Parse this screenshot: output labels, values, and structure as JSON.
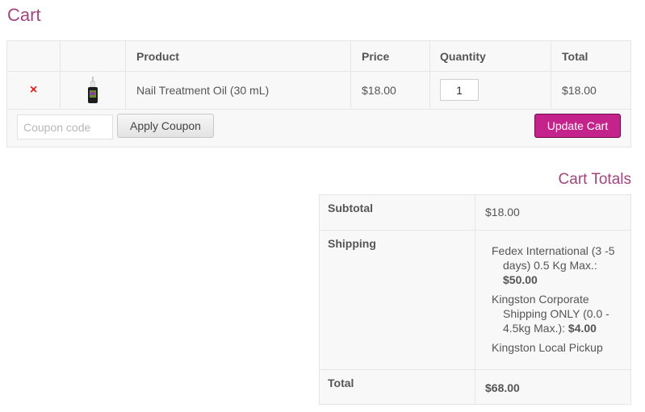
{
  "page": {
    "title": "Cart"
  },
  "cart": {
    "columns": {
      "remove": "",
      "thumbnail": "",
      "product": "Product",
      "price": "Price",
      "quantity": "Quantity",
      "total": "Total"
    },
    "items": [
      {
        "remove_symbol": "×",
        "product": "Nail Treatment Oil (30 mL)",
        "price": "$18.00",
        "quantity": "1",
        "total": "$18.00"
      }
    ],
    "coupon": {
      "placeholder": "Coupon code",
      "value": "",
      "apply_label": "Apply Coupon"
    },
    "update_label": "Update Cart"
  },
  "totals": {
    "title": "Cart Totals",
    "subtotal_label": "Subtotal",
    "subtotal_value": "$18.00",
    "shipping_label": "Shipping",
    "shipping_options": [
      {
        "name": "Fedex International (3 -5 days) 0.5 Kg Max.:",
        "price": "$50.00"
      },
      {
        "name": "Kingston Corporate Shipping ONLY (0.0 - 4.5kg Max.):",
        "price": "$4.00"
      },
      {
        "name": "Kingston Local Pickup",
        "price": ""
      }
    ],
    "total_label": "Total",
    "total_value": "$68.00"
  },
  "colors": {
    "accent": "#a1457e",
    "button": "#c3238a",
    "remove": "#e2211c"
  }
}
